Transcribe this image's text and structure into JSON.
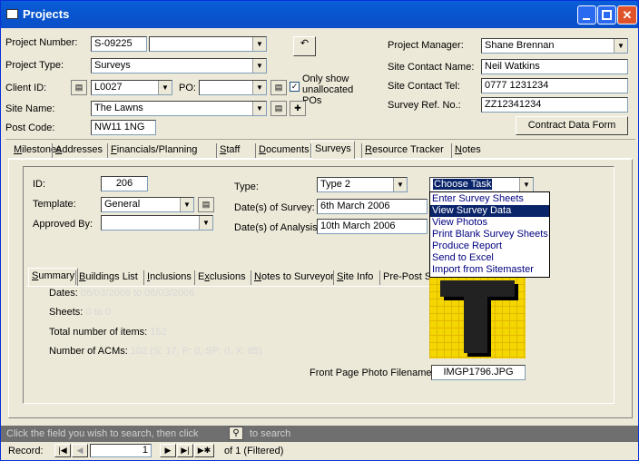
{
  "window": {
    "title": "Projects"
  },
  "header": {
    "project_number_label": "Project Number:",
    "project_number": "S-09225",
    "project_type_label": "Project Type:",
    "project_type": "Surveys",
    "client_id_label": "Client ID:",
    "client_id": "L0027",
    "po_label": "PO:",
    "only_show_label": "Only show unallocated POs",
    "site_name_label": "Site Name:",
    "site_name": "The Lawns",
    "post_code_label": "Post Code:",
    "post_code": "NW11 1NG",
    "project_manager_label": "Project Manager:",
    "project_manager": "Shane Brennan",
    "site_contact_name_label": "Site Contact Name:",
    "site_contact_name": "Neil Watkins",
    "site_contact_tel_label": "Site Contact Tel:",
    "site_contact_tel": "0777 1231234",
    "survey_ref_label": "Survey Ref. No.:",
    "survey_ref": "ZZ12341234",
    "contract_button": "Contract Data Form"
  },
  "tabs": [
    {
      "pre": "",
      "u": "M",
      "post": "ilestones"
    },
    {
      "pre": "",
      "u": "A",
      "post": "ddresses"
    },
    {
      "pre": "",
      "u": "F",
      "post": "inancials/Planning"
    },
    {
      "pre": "",
      "u": "S",
      "post": "taff"
    },
    {
      "pre": "",
      "u": "D",
      "post": "ocuments"
    },
    {
      "pre": "Surveys",
      "u": "",
      "post": ""
    },
    {
      "pre": "",
      "u": "R",
      "post": "esource Tracker"
    },
    {
      "pre": "",
      "u": "N",
      "post": "otes"
    }
  ],
  "survey": {
    "id_label": "ID:",
    "id": "206",
    "template_label": "Template:",
    "template": "General",
    "approved_by_label": "Approved By:",
    "type_label": "Type:",
    "type": "Type 2",
    "date_survey_label": "Date(s) of Survey:",
    "date_survey": "6th March 2006",
    "date_analysis_label": "Date(s) of Analysis:",
    "date_analysis": "10th March 2006",
    "choose_task": "Choose Task"
  },
  "task_menu": [
    "Enter Survey Sheets",
    "View Survey Data",
    "View Photos",
    "Print Blank Survey Sheets",
    "Produce Report",
    "Send to Excel",
    "Import from Sitemaster"
  ],
  "subtabs": [
    {
      "pre": "",
      "u": "S",
      "post": "ummary"
    },
    {
      "pre": "",
      "u": "B",
      "post": "uildings List"
    },
    {
      "pre": "",
      "u": "I",
      "post": "nclusions"
    },
    {
      "pre": "E",
      "u": "x",
      "post": "clusions"
    },
    {
      "pre": "",
      "u": "N",
      "post": "otes to Surveyor"
    },
    {
      "pre": "",
      "u": "S",
      "post": "ite Info"
    },
    {
      "pre": "Pre-Post S",
      "u": "",
      "post": ""
    }
  ],
  "summary": {
    "dates_label": "Dates:",
    "dates": "06/03/2006 to 06/03/2006",
    "sheets_label": "Sheets:",
    "sheets": "0 to 0",
    "total_label": "Total number of items:",
    "total": "152",
    "acms_label": "Number of ACMs:",
    "acms": "102 (S: 17, P: 0, SP: 0, X: 85)",
    "photo_label": "Front Page Photo Filename:",
    "photo": "IMGP1796.JPG"
  },
  "status": {
    "hint_pre": "Click the field you wish to search, then click",
    "hint_post": "to search"
  },
  "nav": {
    "label": "Record:",
    "current": "1",
    "of": "of 1 (Filtered)"
  }
}
